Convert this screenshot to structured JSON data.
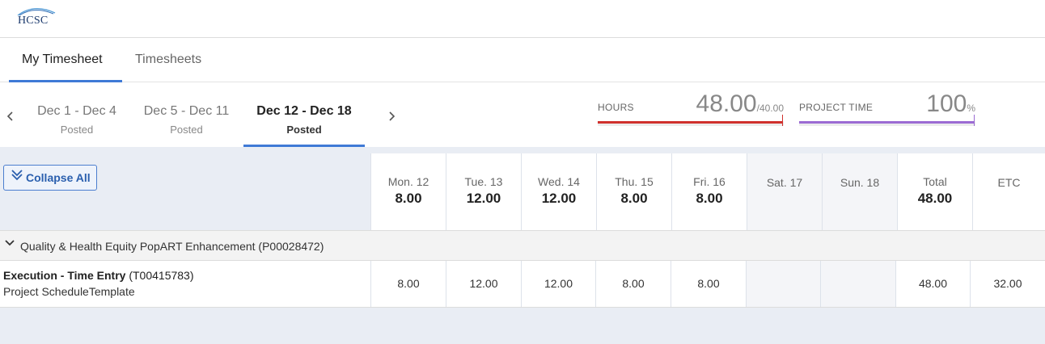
{
  "header": {
    "logo_text": "HCSC"
  },
  "tabs": [
    {
      "label": "My Timesheet",
      "active": true
    },
    {
      "label": "Timesheets",
      "active": false
    }
  ],
  "weeks": [
    {
      "range": "Dec 1 - Dec 4",
      "status": "Posted",
      "active": false
    },
    {
      "range": "Dec 5 - Dec 11",
      "status": "Posted",
      "active": false
    },
    {
      "range": "Dec 12 - Dec 18",
      "status": "Posted",
      "active": true
    }
  ],
  "meters": {
    "hours": {
      "label": "HOURS",
      "value": "48.00",
      "target": "/40.00",
      "color": "#d0312d",
      "fraction": 1.0
    },
    "project_time": {
      "label": "PROJECT TIME",
      "value": "100",
      "unit": "%",
      "color": "#9b6bd3",
      "fraction": 1.0
    }
  },
  "toolbar": {
    "collapse_label": "Collapse All"
  },
  "days": [
    {
      "name": "Mon. 12",
      "hours": "8.00",
      "weekend": false
    },
    {
      "name": "Tue. 13",
      "hours": "12.00",
      "weekend": false
    },
    {
      "name": "Wed. 14",
      "hours": "12.00",
      "weekend": false
    },
    {
      "name": "Thu. 15",
      "hours": "8.00",
      "weekend": false
    },
    {
      "name": "Fri. 16",
      "hours": "8.00",
      "weekend": false
    },
    {
      "name": "Sat. 17",
      "hours": "",
      "weekend": true
    },
    {
      "name": "Sun. 18",
      "hours": "",
      "weekend": true
    }
  ],
  "total": {
    "label": "Total",
    "hours": "48.00"
  },
  "etc": {
    "label": "ETC"
  },
  "project": {
    "title": "Quality & Health Equity PopART Enhancement (P00028472)"
  },
  "task": {
    "name": "Execution - Time Entry",
    "code": "(T00415783)",
    "subtitle": "Project ScheduleTemplate",
    "cells": [
      "8.00",
      "12.00",
      "12.00",
      "8.00",
      "8.00",
      "",
      "",
      "48.00",
      "32.00"
    ]
  },
  "colors": {
    "accent": "#3f7ad6",
    "grid_bg": "#e9edf4"
  }
}
